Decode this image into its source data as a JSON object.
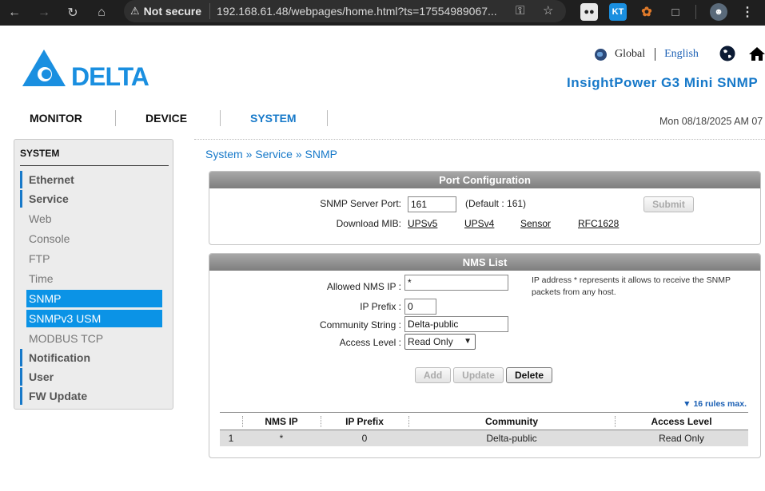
{
  "browser": {
    "security_label": "Not secure",
    "url": "192.168.61.48/webpages/home.html?ts=17554989067...",
    "ext_kt": "KT"
  },
  "header": {
    "logo_text": "DELTA",
    "lang_global": "Global",
    "lang_english": "English",
    "product_title": "InsightPower G3 Mini SNMP"
  },
  "topnav": {
    "tabs": [
      {
        "label": "MONITOR"
      },
      {
        "label": "DEVICE"
      },
      {
        "label": "SYSTEM"
      }
    ],
    "datetime": "Mon 08/18/2025 AM 07"
  },
  "sidebar": {
    "heading": "SYSTEM",
    "items": [
      {
        "label": "Ethernet"
      },
      {
        "label": "Service"
      },
      {
        "label": "Web"
      },
      {
        "label": "Console"
      },
      {
        "label": "FTP"
      },
      {
        "label": "Time"
      },
      {
        "label": "SNMP"
      },
      {
        "label": "SNMPv3 USM"
      },
      {
        "label": "MODBUS TCP"
      },
      {
        "label": "Notification"
      },
      {
        "label": "User"
      },
      {
        "label": "FW Update"
      }
    ]
  },
  "breadcrumb": "System » Service » SNMP",
  "port_config": {
    "title": "Port Configuration",
    "port_label": "SNMP Server Port:",
    "port_value": "161",
    "default_text": "(Default : 161)",
    "submit_label": "Submit",
    "download_label": "Download MIB:",
    "mib_links": [
      "UPSv5",
      "UPSv4",
      "Sensor",
      "RFC1628"
    ]
  },
  "nms_list": {
    "title": "NMS List",
    "allowed_ip_label": "Allowed NMS IP :",
    "allowed_ip_value": "*",
    "ip_note": "IP address * represents it allows to receive the SNMP packets from any host.",
    "prefix_label": "IP Prefix :",
    "prefix_value": "0",
    "community_label": "Community String :",
    "community_value": "Delta-public",
    "access_label": "Access Level :",
    "access_value": "Read Only",
    "add_label": "Add",
    "update_label": "Update",
    "delete_label": "Delete",
    "max_rules": "▼ 16 rules max.",
    "columns": [
      "",
      "NMS IP",
      "IP Prefix",
      "Community",
      "Access Level"
    ],
    "rows": [
      [
        "1",
        "*",
        "0",
        "Delta-public",
        "Read Only"
      ]
    ]
  }
}
